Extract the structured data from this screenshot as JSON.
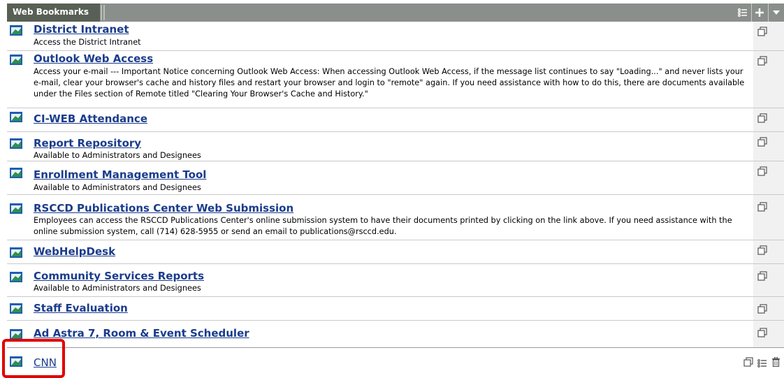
{
  "header": {
    "title": "Web Bookmarks"
  },
  "colors": {
    "header_bg": "#8a8f8c",
    "header_tab_bg": "#586055",
    "link": "#1a3c8c",
    "highlight": "#e00000"
  },
  "bookmarks": [
    {
      "title": "District Intranet",
      "description": "Access the District Intranet"
    },
    {
      "title": "Outlook Web Access",
      "description": "Access your e-mail --- Important Notice concerning Outlook Web Access: When accessing Outlook Web Access, if the message list continues to say \"Loading...\" and never lists your e-mail, clear your browser's cache and history files and restart your browser and login to \"remote\" again. If you need assistance with how to do this, there are documents available under the Files section of Remote titled \"Clearing Your Browser's Cache and History.\""
    },
    {
      "title": "CI-WEB Attendance",
      "description": ""
    },
    {
      "title": "Report Repository",
      "description": "Available to Administrators and Designees"
    },
    {
      "title": "Enrollment Management Tool",
      "description": "Available to Administrators and Designees"
    },
    {
      "title": "RSCCD Publications Center Web Submission",
      "description": "Employees can access the RSCCD Publications Center's online submission system to have their documents printed by clicking on the link above. If you need assistance with the online submission system, call (714) 628-5955 or send an email to publications@rsccd.edu."
    },
    {
      "title": "WebHelpDesk",
      "description": ""
    },
    {
      "title": "Community Services Reports",
      "description": "Available to Administrators and Designees"
    },
    {
      "title": "Staff Evaluation",
      "description": ""
    },
    {
      "title": "Ad Astra 7, Room & Event Scheduler",
      "description": ""
    }
  ],
  "new_bookmark": {
    "title": "CNN"
  }
}
